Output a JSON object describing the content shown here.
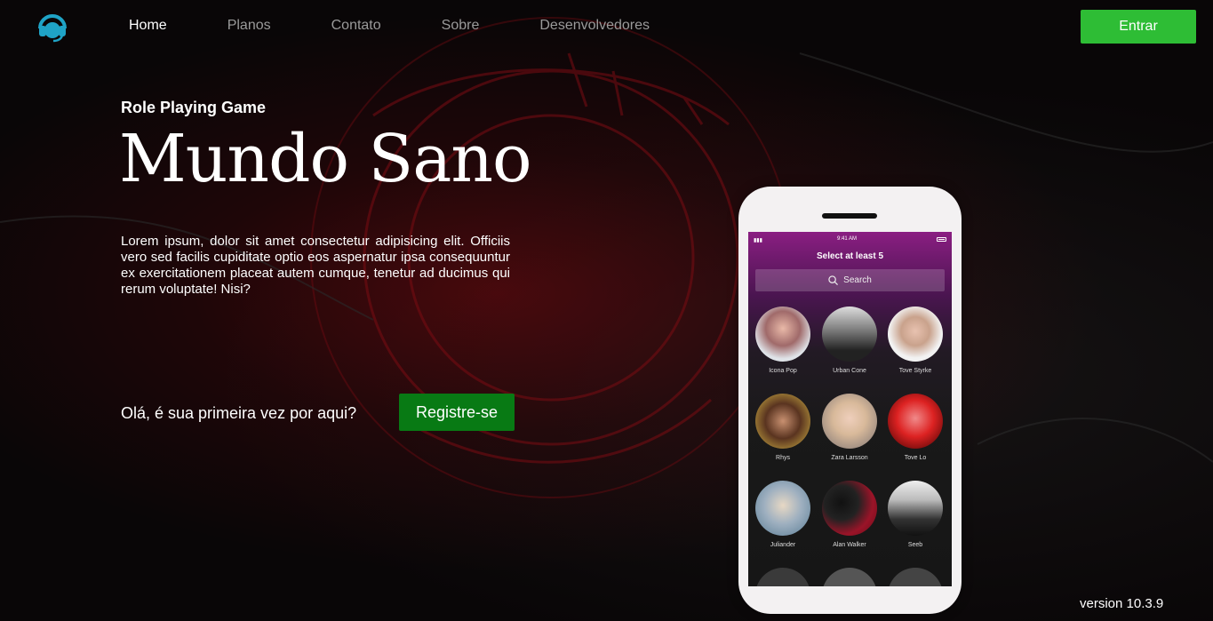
{
  "nav": {
    "logo_icon": "headset-icon",
    "links": [
      {
        "label": "Home",
        "active": true
      },
      {
        "label": "Planos",
        "active": false
      },
      {
        "label": "Contato",
        "active": false
      },
      {
        "label": "Sobre",
        "active": false
      },
      {
        "label": "Desenvolvedores",
        "active": false
      }
    ],
    "enter_label": "Entrar"
  },
  "hero": {
    "kicker": "Role Playing Game",
    "title": "Mundo Sano",
    "description": "Lorem ipsum, dolor sit amet consectetur adipisicing elit. Officiis vero sed facilis cupiditate optio eos aspernatur ipsa consequuntur ex exercitationem placeat autem cumque, tenetur ad ducimus qui rerum voluptate! Nisi?",
    "first_visit": "Olá, é sua primeira vez por aqui?",
    "register_label": "Registre-se"
  },
  "phone": {
    "time": "9:41 AM",
    "screen_title": "Select at least 5",
    "search_placeholder": "Search",
    "artists": [
      {
        "name": "Icona Pop"
      },
      {
        "name": "Urban Cone"
      },
      {
        "name": "Tove Styrke"
      },
      {
        "name": "Rhys"
      },
      {
        "name": "Zara Larsson"
      },
      {
        "name": "Tove Lo"
      },
      {
        "name": "Juliander"
      },
      {
        "name": "Alan Walker"
      },
      {
        "name": "Seeb"
      }
    ]
  },
  "footer": {
    "version": "version 10.3.9"
  },
  "colors": {
    "accent_green": "#2ebd35",
    "register_green": "#087a14",
    "logo_blue": "#1fa3c6",
    "background": "#090607",
    "glow_red": "#8b0d16"
  }
}
